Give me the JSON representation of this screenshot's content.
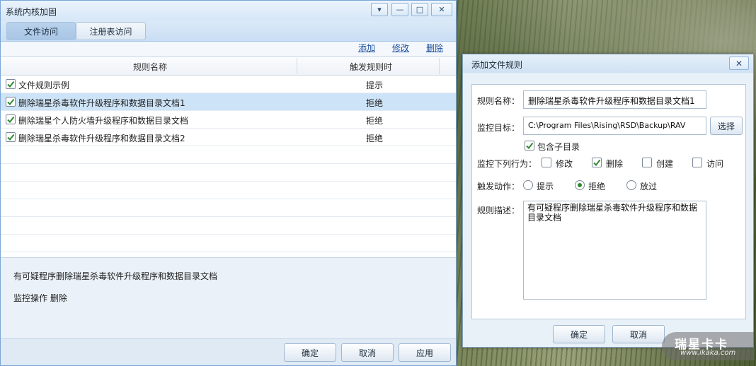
{
  "main_window": {
    "title": "系统内核加固",
    "tabs": [
      {
        "label": "文件访问",
        "active": true
      },
      {
        "label": "注册表访问",
        "active": false
      }
    ],
    "actions": {
      "add": "添加",
      "modify": "修改",
      "delete": "删除"
    },
    "table": {
      "columns": [
        "规则名称",
        "触发规则时"
      ],
      "rows": [
        {
          "checked": true,
          "name": "文件规则示例",
          "action": "提示",
          "selected": false
        },
        {
          "checked": true,
          "name": "删除瑞星杀毒软件升级程序和数据目录文档1",
          "action": "拒绝",
          "selected": true
        },
        {
          "checked": true,
          "name": "删除瑞星个人防火墙升级程序和数据目录文档",
          "action": "拒绝",
          "selected": false
        },
        {
          "checked": true,
          "name": "删除瑞星杀毒软件升级程序和数据目录文档2",
          "action": "拒绝",
          "selected": false
        }
      ]
    },
    "description": "有可疑程序删除瑞星杀毒软件升级程序和数据目录文档",
    "monitor_operation": "监控操作 删除",
    "buttons": {
      "ok": "确定",
      "cancel": "取消",
      "apply": "应用"
    }
  },
  "dialog": {
    "title": "添加文件规则",
    "rule_name_label": "规则名称：",
    "rule_name_value": "删除瑞星杀毒软件升级程序和数据目录文档1",
    "target_label": "监控目标：",
    "target_value": "C:\\Program Files\\Rising\\RSD\\Backup\\RAV",
    "select_button": "选择",
    "include_subdir": {
      "label": "包含子目录",
      "checked": true
    },
    "behavior_label": "监控下列行为：",
    "behaviors": [
      {
        "label": "修改",
        "checked": false
      },
      {
        "label": "删除",
        "checked": true
      },
      {
        "label": "创建",
        "checked": false
      },
      {
        "label": "访问",
        "checked": false
      }
    ],
    "action_label": "触发动作：",
    "actions": [
      {
        "label": "提示",
        "selected": false
      },
      {
        "label": "拒绝",
        "selected": true
      },
      {
        "label": "放过",
        "selected": false
      }
    ],
    "description_label": "规则描述：",
    "description_value": "有可疑程序删除瑞星杀毒软件升级程序和数据目录文档",
    "ok_button": "确定",
    "cancel_button": "取消"
  },
  "watermark": {
    "brand": "瑞星卡卡",
    "url": "www.ikaka.com"
  },
  "colors": {
    "accent": "#1a4f9c",
    "selected_row": "#cde3f7",
    "check_green": "#2f8a2f"
  }
}
